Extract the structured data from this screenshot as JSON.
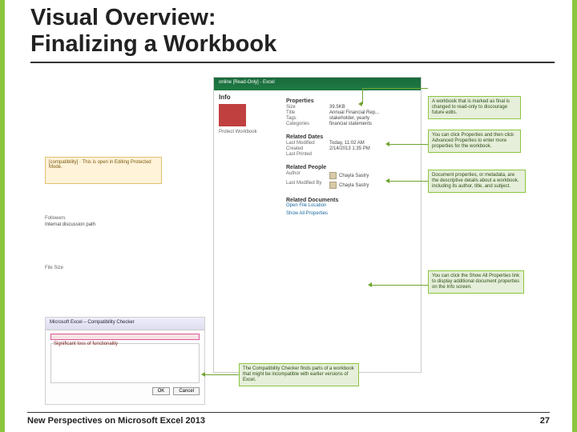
{
  "slide": {
    "title_line1": "Visual Overview:",
    "title_line2": "Finalizing a Workbook",
    "footer_left": "New Perspectives on Microsoft Excel 2013",
    "footer_right": "27"
  },
  "info": {
    "topbar": "online [Read-Only] - Excel",
    "left_label1": "Info",
    "left_label2": "Protect Workbook",
    "properties_hdr": "Properties",
    "props": {
      "size_l": "Size",
      "size_v": "39.5KB",
      "title_l": "Title",
      "title_v": "Annual Financial Rep...",
      "tags_l": "Tags",
      "tags_v": "stakeholder, yearly",
      "cat_l": "Categories",
      "cat_v": "financial statements"
    },
    "dates_hdr": "Related Dates",
    "dates": {
      "lm_l": "Last Modified",
      "lm_v": "Today, 11:02 AM",
      "cr_l": "Created",
      "cr_v": "2/14/2013 1:35 PM",
      "lp_l": "Last Printed",
      "lp_v": ""
    },
    "people_hdr": "Related People",
    "people": {
      "author_l": "Author",
      "author_v": "Chayla Sastry",
      "lmb_l": "Last Modified By",
      "lmb_v": "Chayla Sastry"
    },
    "docs_hdr": "Related Documents",
    "open_loc": "Open File Location",
    "show_all": "Show All Properties"
  },
  "leftpanel": {
    "note_top": "[compatibility] · This is open in Editing Protected Mode.",
    "note_followers_l": "Followers",
    "note_followers_v": "Internal discussion path",
    "note_filesize_l": "File Size"
  },
  "dlg": {
    "title": "Microsoft Excel – Compatibility Checker",
    "row": "Significant loss of functionality",
    "ok": "OK",
    "cancel": "Cancel"
  },
  "callouts": {
    "c1": "A workbook that is marked as final is changed to read-only to discourage future edits.",
    "c2": "You can click Properties and then click Advanced Properties to enter more properties for the workbook.",
    "c3": "Document properties, or metadata, are the descriptive details about a workbook, including its author, title, and subject.",
    "c4": "You can click the Show All Properties link to display additional document properties on the Info screen.",
    "c5": "The Compatibility Checker finds parts of a workbook that might be incompatible with earlier versions of Excel."
  }
}
